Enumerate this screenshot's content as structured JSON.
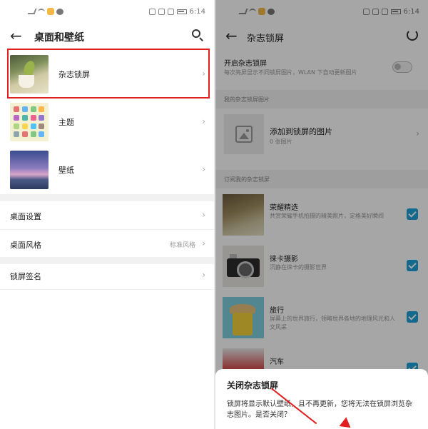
{
  "left": {
    "status_time": "6:14",
    "header": {
      "title": "桌面和壁纸"
    },
    "items": [
      {
        "label": "杂志锁屏"
      },
      {
        "label": "主题"
      },
      {
        "label": "壁纸"
      }
    ],
    "settings": [
      {
        "label": "桌面设置",
        "value": ""
      },
      {
        "label": "桌面风格",
        "value": "标准风格"
      }
    ],
    "lock_signature": {
      "label": "锁屏签名"
    }
  },
  "right": {
    "status_time": "6:14",
    "header": {
      "title": "杂志锁屏"
    },
    "toggle": {
      "title": "开启杂志锁屏",
      "subtitle": "每次亮屏显示不同锁屏图片，WLAN 下自动更新图片",
      "enabled": false
    },
    "my_section": {
      "label": "我的杂志锁屏图片"
    },
    "add_item": {
      "title": "添加到锁屏的图片",
      "subtitle": "0 张图片"
    },
    "subscribed_section": {
      "label": "订阅我的杂志锁屏"
    },
    "subscriptions": [
      {
        "title": "荣耀精选",
        "desc": "共赏荣耀手机拍摄的精美照片，定格美好瞬间",
        "checked": true
      },
      {
        "title": "徕卡摄影",
        "desc": "沉静在徕卡的摄影世界",
        "checked": true
      },
      {
        "title": "旅行",
        "desc": "屏幕上的世界旅行，领略世界各地的地理风光和人文风采",
        "checked": true
      },
      {
        "title": "汽车",
        "desc": "",
        "checked": true
      }
    ],
    "dialog": {
      "title": "关闭杂志锁屏",
      "body": "锁屏将显示默认壁纸，且不再更新，您将无法在锁屏浏览杂志图片。是否关闭？"
    }
  },
  "colors": {
    "highlight": "#e02020",
    "accent": "#1ea1d8"
  }
}
